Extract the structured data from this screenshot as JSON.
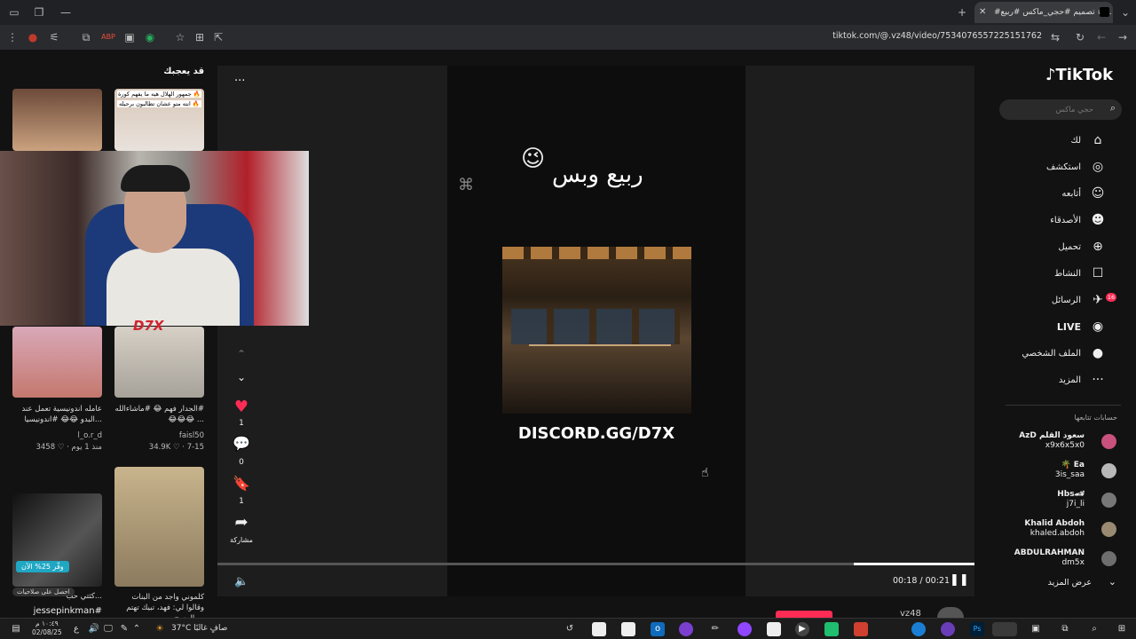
{
  "browser": {
    "tab_title": "#تصميم #حجي_ماكس #ربيع #...",
    "url": "tiktok.com/@.vz48/video/7534076557225151762"
  },
  "recommend": {
    "title": "قد يعجبك",
    "items": [
      {
        "overlay1": "جمهور الهلال هيه ما يفهم كورة 🔥",
        "overlay2": "انته متو عشان تطالبون برحيله 🔥"
      },
      {
        "caption": "عامله اندونيسية تعمل عند البدو 😂😂 #اندونيسيا...",
        "author": "l_o.r_d",
        "stats": "3458 ♡ · منذ 1 يوم"
      },
      {
        "caption": "الجدار فهم 😂 #ماشاءالله# 😂😂😂 ...",
        "author": "faisl50",
        "stats": "34.9K ♡ · 7-15"
      },
      {
        "caption": "كثتي حب...",
        "author": "jessepinkman#",
        "overlay": "وفّر 25% الآن",
        "badge": "احصل على صلاحيات"
      },
      {
        "caption": "كلموني واجد من البنات وقالوا لي: فهد، تبيك تهتم بالمسج...",
        "author": ""
      }
    ]
  },
  "webcam": {
    "logo": "D7X"
  },
  "video": {
    "more": "···",
    "title_text": "ربيع وبس",
    "emoji": "😉",
    "discord": "DISCORD.GG/D7X",
    "time": "00:18 / 00:21",
    "progress": 0.16,
    "author": "vz48"
  },
  "actions": {
    "likes": "1",
    "comments": "0",
    "saves": "1",
    "share": "مشاركة"
  },
  "sidebar": {
    "logo": "TikTok",
    "search_placeholder": "حجي ماكس",
    "nav": [
      {
        "label": "لك",
        "icon": "home-icon"
      },
      {
        "label": "استكشف",
        "icon": "compass-icon"
      },
      {
        "label": "أتابعه",
        "icon": "following-icon"
      },
      {
        "label": "الأصدقاء",
        "icon": "friends-icon"
      },
      {
        "label": "تحميل",
        "icon": "upload-icon"
      },
      {
        "label": "النشاط",
        "icon": "activity-icon"
      },
      {
        "label": "الرسائل",
        "icon": "messages-icon",
        "badge": "16"
      },
      {
        "label": "LIVE",
        "icon": "live-icon"
      },
      {
        "label": "الملف الشخصي",
        "icon": "profile-icon"
      },
      {
        "label": "المزيد",
        "icon": "more-icon"
      }
    ],
    "following_title": "حسابات تتابعها",
    "following": [
      {
        "name": "AzD سعود القلم",
        "handle": "x9x6x5x0"
      },
      {
        "name": "🌴 Ea",
        "handle": "3is_saa"
      },
      {
        "name": "Hbs🏎",
        "handle": "j7i_li"
      },
      {
        "name": "Khalid Abdoh",
        "handle": "khaled.abdoh"
      },
      {
        "name": "ABDULRAHMAN",
        "handle": "dm5x"
      }
    ],
    "show_more": "عرض المزيد"
  },
  "taskbar": {
    "weather": "37°C صافٍ غالبًا",
    "time": "١٠:٤٩ م",
    "date": "02/08/25",
    "lang": "ع"
  }
}
